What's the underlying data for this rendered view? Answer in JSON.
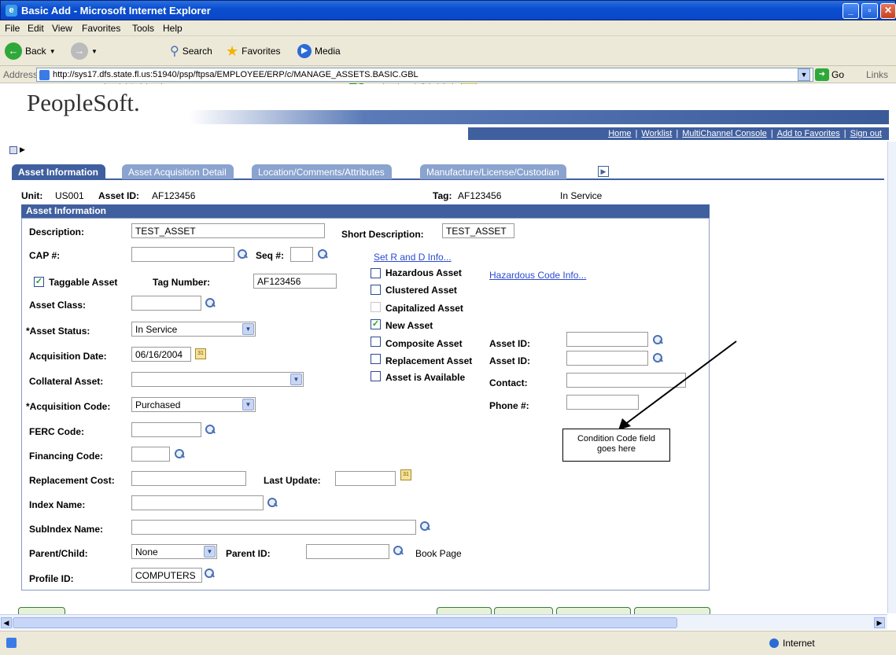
{
  "window": {
    "title": "Basic Add - Microsoft Internet Explorer"
  },
  "menubar": [
    "File",
    "Edit",
    "View",
    "Favorites",
    "Tools",
    "Help"
  ],
  "toolbar": {
    "back": "Back",
    "search": "Search",
    "favorites": "Favorites",
    "media": "Media"
  },
  "address": {
    "label": "Address",
    "url": "http://sys17.dfs.state.fl.us:51940/psp/ftpsa/EMPLOYEE/ERP/c/MANAGE_ASSETS.BASIC.GBL",
    "go": "Go",
    "links": "Links"
  },
  "header": {
    "logo": "PeopleSoft.",
    "links": [
      "Home",
      "Worklist",
      "MultiChannel Console",
      "Add to Favorites",
      "Sign out"
    ]
  },
  "tabs": [
    "Asset Information",
    "Asset Acquisition Detail",
    "Location/Comments/Attributes",
    "Manufacture/License/Custodian"
  ],
  "summary": {
    "unit_label": "Unit:",
    "unit": "US001",
    "asset_id_label": "Asset ID:",
    "asset_id": "AF123456",
    "tag_label": "Tag:",
    "tag": "AF123456",
    "status": "In Service"
  },
  "section_title": "Asset Information",
  "form": {
    "description_label": "Description:",
    "description": "TEST_ASSET",
    "short_description_label": "Short Description:",
    "short_description": "TEST_ASSET",
    "cap_label": "CAP #:",
    "seq_label": "Seq #:",
    "set_r_and_d": "Set R and D Info...",
    "taggable_label": "Taggable Asset",
    "tag_number_label": "Tag Number:",
    "tag_number": "AF123456",
    "asset_class_label": "Asset Class:",
    "asset_status_label": "*Asset Status:",
    "asset_status": "In Service",
    "acquisition_date_label": "Acquisition Date:",
    "acquisition_date": "06/16/2004",
    "collateral_asset_label": "Collateral Asset:",
    "acquisition_code_label": "*Acquisition Code:",
    "acquisition_code": "Purchased",
    "ferc_code_label": "FERC Code:",
    "financing_code_label": "Financing Code:",
    "replacement_cost_label": "Replacement Cost:",
    "last_update_label": "Last Update:",
    "index_name_label": "Index Name:",
    "subindex_name_label": "SubIndex Name:",
    "parent_child_label": "Parent/Child:",
    "parent_child": "None",
    "parent_id_label": "Parent ID:",
    "book_page": "Book Page",
    "profile_id_label": "Profile ID:",
    "profile_id": "COMPUTERS",
    "hazardous_label": "Hazardous Asset",
    "hazardous_link": "Hazardous Code Info...",
    "clustered_label": "Clustered Asset",
    "capitalized_label": "Capitalized Asset",
    "new_asset_label": "New Asset",
    "composite_label": "Composite Asset",
    "replacement_label": "Replacement Asset",
    "available_label": "Asset is Available",
    "asset_id_label": "Asset ID:",
    "contact_label": "Contact:",
    "phone_label": "Phone #:"
  },
  "annotation": {
    "line1": "Condition Code field",
    "line2": "goes here"
  },
  "status_zone": "Internet"
}
